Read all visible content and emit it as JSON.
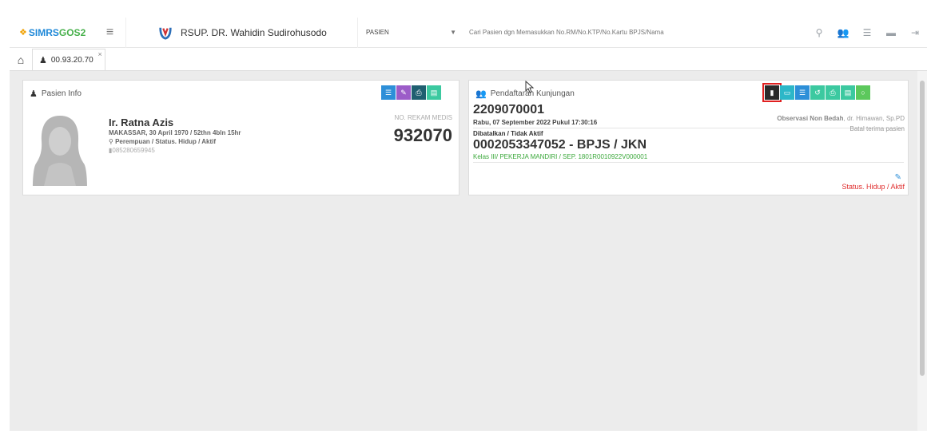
{
  "brand": {
    "prefix": "SIMRS",
    "suffix": "GOS2",
    "dot": "❖"
  },
  "menu_icon": "hamburger-icon",
  "hospital": {
    "name": "RSUP. DR. Wahidin Sudirohusodo"
  },
  "search": {
    "type_selected": "PASIEN",
    "placeholder": "Cari Pasien dgn Memasukkan No.RM/No.KTP/No.Kartu BPJS/Nama"
  },
  "top_icons": [
    "search-icon",
    "user-add-icon",
    "list-icon",
    "folder-icon",
    "logout-icon"
  ],
  "tabs": {
    "home_icon": "home-icon",
    "patient_tab": {
      "label": "00.93.20.70",
      "close": "×"
    }
  },
  "patient_card": {
    "title": "Pasien Info",
    "name": "Ir. Ratna Azis",
    "birth": "MAKASSAR, 30 April 1970 / 52thn 4bln 15hr",
    "gender_status": "Perempuan / Status. Hidup / Aktif",
    "phone": "085280659945",
    "rm_label": "NO. REKAM MEDIS",
    "rm_number": "932070",
    "buttons": [
      "list-icon",
      "edit-icon",
      "print-icon",
      "grid-icon"
    ]
  },
  "visit_card": {
    "title": "Pendaftaran Kunjungan",
    "registration_no": "2209070001",
    "date": "Rabu, 07 September 2022 Pukul 17:30:16",
    "status": "Dibatalkan / Tidak Aktif",
    "insurance": "0002053347052 - BPJS / JKN",
    "kelas": "Kelas III/ PEKERJA MANDIRI / SEP. 1801R0010922V000001",
    "department": "Observasi Non Bedah",
    "doctor": ", dr. Himawan, Sp.PD",
    "batal": "Batal terima pasien",
    "alive_status": "Status. Hidup / Aktif",
    "buttons": [
      "document-icon",
      "card-icon",
      "list-icon",
      "undo-icon",
      "print-icon",
      "grid-icon",
      "circle-icon"
    ]
  },
  "colors": {
    "accent": "#2d8fd8",
    "green": "#3aa83a",
    "danger": "#e03030",
    "highlight": "#e02020"
  }
}
